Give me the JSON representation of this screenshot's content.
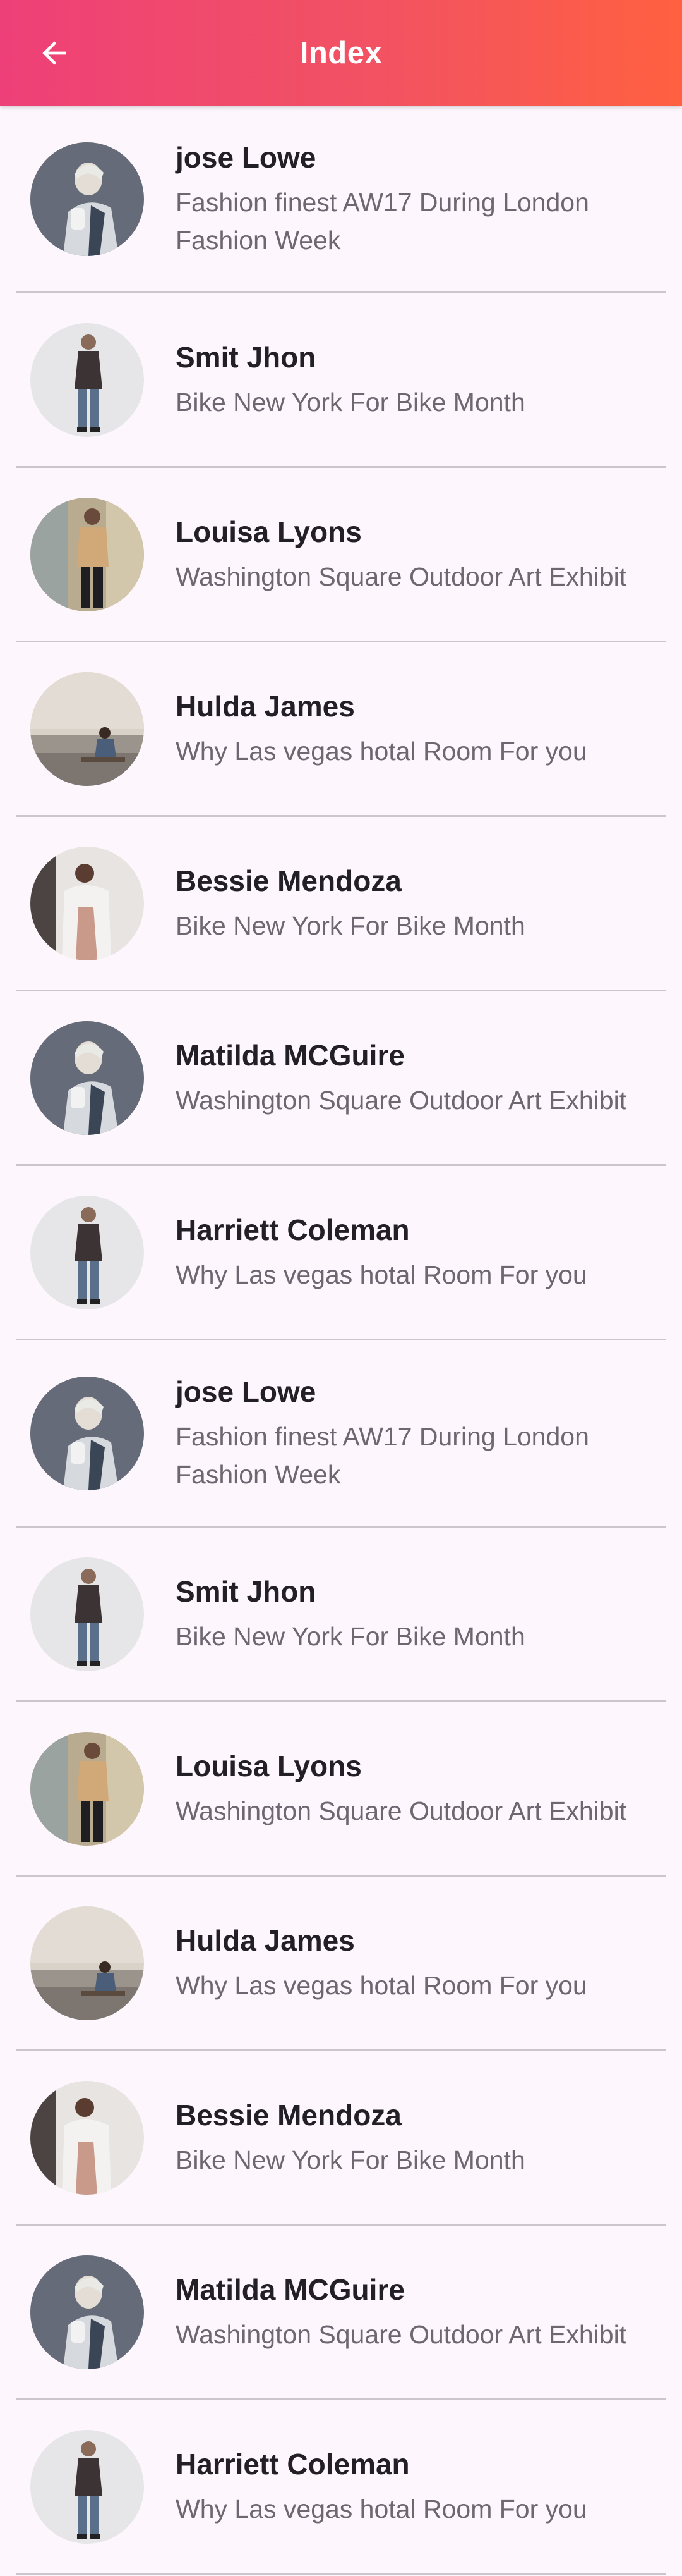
{
  "app_bar": {
    "title": "Index",
    "back_icon": "arrow-back-icon",
    "gradient_start": "#ee4078",
    "gradient_end": "#ff6040"
  },
  "list": [
    {
      "name": "jose Lowe",
      "subtitle": "Fashion finest AW17 During London Fashion Week",
      "avatar": "avatar-1"
    },
    {
      "name": "Smit Jhon",
      "subtitle": "Bike New York For Bike Month",
      "avatar": "avatar-2"
    },
    {
      "name": "Louisa Lyons",
      "subtitle": "Washington Square Outdoor Art Exhibit",
      "avatar": "avatar-3"
    },
    {
      "name": "Hulda James",
      "subtitle": "Why Las vegas hotal Room For you",
      "avatar": "avatar-4"
    },
    {
      "name": "Bessie Mendoza",
      "subtitle": "Bike New York For Bike Month",
      "avatar": "avatar-5"
    },
    {
      "name": "Matilda MCGuire",
      "subtitle": "Washington Square Outdoor Art Exhibit",
      "avatar": "avatar-1"
    },
    {
      "name": "Harriett Coleman",
      "subtitle": "Why Las vegas hotal Room For you",
      "avatar": "avatar-2"
    },
    {
      "name": "jose Lowe",
      "subtitle": "Fashion finest AW17 During London Fashion Week",
      "avatar": "avatar-1"
    },
    {
      "name": "Smit Jhon",
      "subtitle": "Bike New York For Bike Month",
      "avatar": "avatar-2"
    },
    {
      "name": "Louisa Lyons",
      "subtitle": "Washington Square Outdoor Art Exhibit",
      "avatar": "avatar-3"
    },
    {
      "name": "Hulda James",
      "subtitle": "Why Las vegas hotal Room For you",
      "avatar": "avatar-4"
    },
    {
      "name": "Bessie Mendoza",
      "subtitle": "Bike New York For Bike Month",
      "avatar": "avatar-5"
    },
    {
      "name": "Matilda MCGuire",
      "subtitle": "Washington Square Outdoor Art Exhibit",
      "avatar": "avatar-1"
    },
    {
      "name": "Harriett Coleman",
      "subtitle": "Why Las vegas hotal Room For you",
      "avatar": "avatar-2"
    }
  ]
}
